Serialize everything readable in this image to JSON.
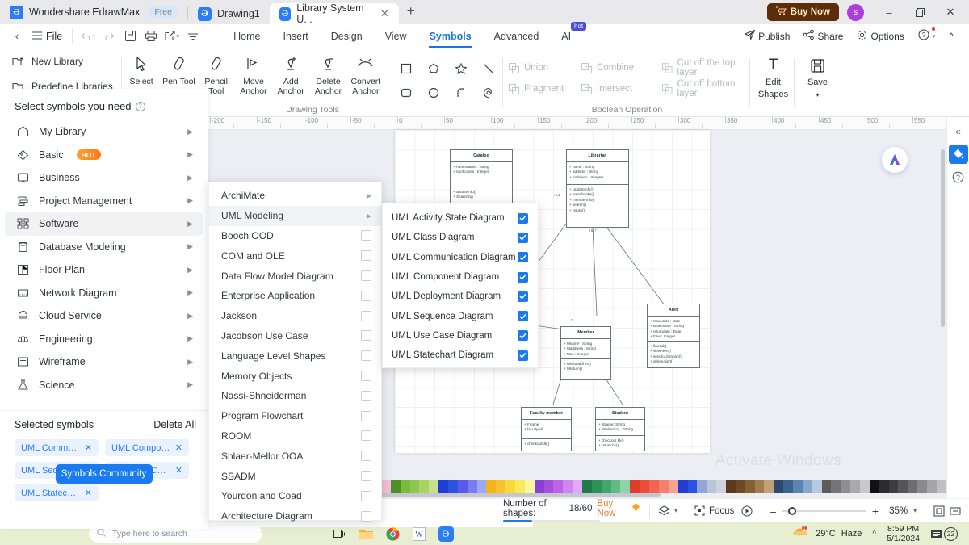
{
  "titlebar": {
    "app_name": "Wondershare EdrawMax",
    "free_badge": "Free",
    "tabs": [
      {
        "label": "Drawing1",
        "active": false
      },
      {
        "label": "Library System U...",
        "active": true
      }
    ],
    "new_tab": "+",
    "buy_now": "Buy Now",
    "avatar_initial": "s",
    "minimize": "–",
    "maximize": "❐",
    "close": "✕"
  },
  "menubar": {
    "back": "‹",
    "file": "File",
    "undo": "↺",
    "redo": "↻",
    "save": "save-icon",
    "print": "print-icon",
    "export": "export-icon",
    "more": "more-icon",
    "ribbon_tabs": [
      {
        "label": "Home",
        "active": false
      },
      {
        "label": "Insert",
        "active": false
      },
      {
        "label": "Design",
        "active": false
      },
      {
        "label": "View",
        "active": false
      },
      {
        "label": "Symbols",
        "active": true
      },
      {
        "label": "Advanced",
        "active": false
      },
      {
        "label": "AI",
        "active": false,
        "badge": "hot"
      }
    ],
    "right_items": [
      {
        "label": "Publish",
        "icon": "publish-icon"
      },
      {
        "label": "Share",
        "icon": "share-icon"
      },
      {
        "label": "Options",
        "icon": "gear-icon"
      }
    ],
    "help": "?",
    "collapse": "^"
  },
  "ribbon": {
    "library_group": {
      "new_library": "New Library",
      "predefine_libraries": "Predefine Libraries"
    },
    "drawing_tools": {
      "group_label": "Drawing Tools",
      "tools": [
        {
          "label": "Select",
          "icon": "cursor-icon"
        },
        {
          "label": "Pen Tool",
          "icon": "pen-icon"
        },
        {
          "label": "Pencil Tool",
          "icon": "pencil-icon"
        },
        {
          "label": "Move Anchor",
          "icon": "move-anchor-icon"
        },
        {
          "label": "Add Anchor",
          "icon": "add-anchor-icon"
        },
        {
          "label": "Delete Anchor",
          "icon": "delete-anchor-icon"
        },
        {
          "label": "Convert Anchor",
          "icon": "convert-anchor-icon"
        }
      ],
      "shapes": [
        "square-icon",
        "pentagon-icon",
        "star-icon",
        "line-icon",
        "rounded-rect-icon",
        "circle-icon",
        "arc-icon",
        "spiral-icon"
      ]
    },
    "boolean": {
      "group_label": "Boolean Operation",
      "items": [
        "Union",
        "Combine",
        "Cut off the top layer",
        "Fragment",
        "Intersect",
        "Cut off bottom layer"
      ]
    },
    "edit_shapes": {
      "line1": "Edit",
      "line2": "Shapes",
      "icon": "text-t-icon"
    },
    "save_btn": {
      "label": "Save",
      "icon": "floppy-icon"
    }
  },
  "left_panel": {
    "header": "Select symbols you need",
    "items": [
      {
        "label": "My Library",
        "icon": "home-icon",
        "active": false
      },
      {
        "label": "Basic",
        "icon": "tag-icon",
        "active": false,
        "badge": "HOT"
      },
      {
        "label": "Business",
        "icon": "presentation-icon",
        "active": false
      },
      {
        "label": "Project Management",
        "icon": "gantt-icon",
        "active": false
      },
      {
        "label": "Software",
        "icon": "software-icon",
        "active": true
      },
      {
        "label": "Database Modeling",
        "icon": "database-icon",
        "active": false
      },
      {
        "label": "Floor Plan",
        "icon": "floorplan-icon",
        "active": false
      },
      {
        "label": "Network Diagram",
        "icon": "network-icon",
        "active": false
      },
      {
        "label": "Cloud Service",
        "icon": "cloud-icon",
        "active": false
      },
      {
        "label": "Engineering",
        "icon": "helmet-icon",
        "active": false
      },
      {
        "label": "Wireframe",
        "icon": "wireframe-icon",
        "active": false
      },
      {
        "label": "Science",
        "icon": "flask-icon",
        "active": false
      }
    ],
    "selected_symbols_label": "Selected symbols",
    "delete_all": "Delete All",
    "chips": [
      "UML Communi...",
      "UML Compone...",
      "UML Sequence ...",
      "UML Use Case D...",
      "UML Statechart ..."
    ],
    "symbols_community": "Symbols Community"
  },
  "dropdown": {
    "items": [
      {
        "label": "ArchiMate",
        "type": "arrow",
        "active": false
      },
      {
        "label": "UML Modeling",
        "type": "arrow",
        "active": true
      },
      {
        "label": "Booch OOD",
        "type": "checkbox",
        "checked": false
      },
      {
        "label": "COM and OLE",
        "type": "checkbox",
        "checked": false
      },
      {
        "label": "Data Flow Model Diagram",
        "type": "checkbox",
        "checked": false
      },
      {
        "label": "Enterprise Application",
        "type": "checkbox",
        "checked": false
      },
      {
        "label": "Jackson",
        "type": "checkbox",
        "checked": false
      },
      {
        "label": "Jacobson Use Case",
        "type": "checkbox",
        "checked": false
      },
      {
        "label": "Language Level Shapes",
        "type": "checkbox",
        "checked": false
      },
      {
        "label": "Memory Objects",
        "type": "checkbox",
        "checked": false
      },
      {
        "label": "Nassi-Shneiderman",
        "type": "checkbox",
        "checked": false
      },
      {
        "label": "Program Flowchart",
        "type": "checkbox",
        "checked": false
      },
      {
        "label": "ROOM",
        "type": "checkbox",
        "checked": false
      },
      {
        "label": "Shlaer-Mellor OOA",
        "type": "checkbox",
        "checked": false
      },
      {
        "label": "SSADM",
        "type": "checkbox",
        "checked": false
      },
      {
        "label": "Yourdon and Coad",
        "type": "checkbox",
        "checked": false
      },
      {
        "label": "Architecture Diagram",
        "type": "checkbox",
        "checked": false
      }
    ]
  },
  "submenu": {
    "items": [
      {
        "label": "UML Activity State Diagram",
        "checked": true
      },
      {
        "label": "UML Class Diagram",
        "checked": true
      },
      {
        "label": "UML Communication Diagram",
        "checked": true
      },
      {
        "label": "UML Component Diagram",
        "checked": true
      },
      {
        "label": "UML Deployment Diagram",
        "checked": true
      },
      {
        "label": "UML Sequence Diagram",
        "checked": true
      },
      {
        "label": "UML Use Case Diagram",
        "checked": true
      },
      {
        "label": "UML Statechart Diagram",
        "checked": true
      }
    ]
  },
  "canvas": {
    "ruler_ticks": [
      "-200",
      "-150",
      "-100",
      "-50",
      "0",
      "50",
      "100",
      "150",
      "200",
      "250",
      "300",
      "350",
      "400",
      "450",
      "500",
      "550"
    ],
    "watermark": "Activate Windows",
    "classes": [
      {
        "name": "Catalog",
        "attributes": [
          "Authorname : String",
          "noofcopies : Integer"
        ],
        "methods": [
          "updateInfo()",
          "Searching"
        ]
      },
      {
        "name": "Librarian",
        "attributes": [
          "name : String",
          "address : String",
          "mobileno : Integrer"
        ],
        "methods": [
          "UpdateInfo()",
          "Issuebooks()",
          "memberInfo()",
          "search()",
          "return()"
        ]
      },
      {
        "name": "Member",
        "attributes": [
          "Mname : String",
          "Maddress : String",
          "Mno : Integer"
        ],
        "methods": [
          "reissuedtfl'ns()",
          "Mreturn()"
        ]
      },
      {
        "name": "Alert",
        "attributes": [
          "Issuedate : Date",
          "Bookname : String",
          "returndate : Date",
          "Fine : Integer"
        ],
        "methods": [
          "finecal()",
          "viewAlert()",
          "sendtoLibrarian()",
          "deleteAlert()"
        ]
      },
      {
        "name": "Faculty member",
        "attributes": [
          "Fname",
          "facultyaid"
        ],
        "methods": [
          "checkoutsfk()"
        ]
      },
      {
        "name": "Student",
        "attributes": [
          "sName: String",
          "Studentcat. : String"
        ],
        "methods": [
          "checkout bk()",
          "return bk()"
        ]
      }
    ],
    "multiplicities": [
      "+1,2",
      "+1..*",
      "*",
      "*",
      "*"
    ]
  },
  "statusbar": {
    "shapes_label": "Number of shapes:",
    "shapes_count": "18/60",
    "buy_now": "Buy Now",
    "layers": "layers-icon",
    "focus": "Focus",
    "play": "play-icon",
    "zoom_out": "–",
    "zoom_in": "+",
    "zoom_level": "35%",
    "fit_page": "fit-page-icon",
    "fit_width": "fit-width-icon"
  },
  "taskbar": {
    "search_placeholder": "Type here to search",
    "icons": [
      "task-view-icon",
      "folder-icon",
      "chrome-icon",
      "word-icon",
      "edraw-icon"
    ],
    "weather": "29°C",
    "condition": "Haze",
    "chevron": "^",
    "time": "8:59 PM",
    "date": "5/1/2024",
    "notification_count": "22"
  },
  "colors": {
    "accent": "#1a7bf0",
    "buy_now_bg": "#5c2d0c",
    "hot_badge": "#ff7a18",
    "palette": [
      "#f3c0d2",
      "#4f8c2a",
      "#79bb3c",
      "#8fc74c",
      "#a8d35f",
      "#c7e08a",
      "#1f3fd4",
      "#2b53e0",
      "#5a5ae8",
      "#7b7bef",
      "#9aa8f5",
      "#f5b319",
      "#f7c32c",
      "#f8d73f",
      "#fae95b",
      "#fdf7a0",
      "#8a3fd4",
      "#a44ee0",
      "#bd63e8",
      "#cf86ef",
      "#e2aaf6",
      "#1f7a4a",
      "#2d9057",
      "#3fa86a",
      "#5fbd84",
      "#8fd3a8",
      "#e03b2b",
      "#ec4b38",
      "#f26450",
      "#f6806f",
      "#f8a294",
      "#1f3fd4",
      "#2b53e0"
    ]
  }
}
